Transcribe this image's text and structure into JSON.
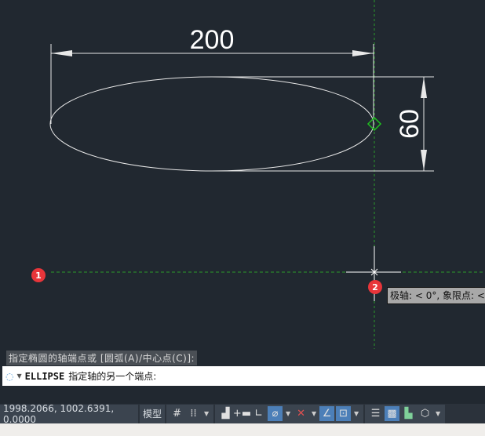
{
  "drawing": {
    "dim_horizontal": "200",
    "dim_vertical": "60"
  },
  "markers": [
    "1",
    "2"
  ],
  "tooltip": "极轴: < 0°, 象限点: <",
  "command": {
    "history": "指定椭圆的轴端点或 [圆弧(A)/中心点(C)]:",
    "name": "ELLIPSE",
    "prompt": "指定轴的另一个端点:"
  },
  "status": {
    "coords": "1998.2066, 1002.6391, 0.0000",
    "model_tab": "模型"
  },
  "colors": {
    "background": "#212830",
    "accent": "#4c7fb8",
    "marker": "#e8353a",
    "tracking": "#2aa02a"
  }
}
